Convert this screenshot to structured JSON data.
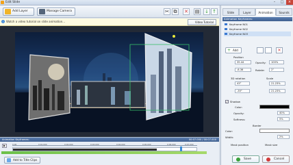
{
  "window": {
    "title": "Edit Slide"
  },
  "toolbar": {
    "add_layer": "Add Layer",
    "manage_camera": "Manage Camera"
  },
  "info": {
    "text": "Watch a video tutorial on slide animation...",
    "video_tutorial": "Video Tutorial"
  },
  "tabs": [
    "Slide",
    "Layer",
    "Animation",
    "Sounds"
  ],
  "keyframes": {
    "header": "Animation Keyframes:",
    "items": [
      "Keyframe N01",
      "Keyframe N02",
      "Keyframe N03"
    ],
    "add": "Add"
  },
  "props": {
    "position_hdr": "Position",
    "x": "35.44",
    "y": "-6.36",
    "opacity": "100%",
    "rotate": "2°",
    "rotation_hdr": "3D rotation",
    "rx": "43°",
    "ry": "-35°",
    "scale_hdr": "Scale",
    "sx": "21.23%",
    "sy": "21.23%",
    "opacity_lbl": "Opacity:",
    "rotate_lbl": "Rotate:",
    "shadow": "Shadow",
    "color": "Color:",
    "shadow_opacity": "Opacity:",
    "shadow_opacity_val": "40%",
    "softness": "Softness:",
    "softness_val": "5%",
    "border_hdr": "Border",
    "border_color": "Color:",
    "width": "Width:",
    "width_val": "2%",
    "mask_position": "Mask position",
    "mask_size": "Mask size"
  },
  "timeline": {
    "header": "Animation Keyframes:",
    "time": "00:07.000 / 00:07.000",
    "ticks": [
      "0:00",
      "0:01.000",
      "0:02.000",
      "0:03.000",
      "0:04.000",
      "0:05.000",
      "0:06.000",
      "0:07.000"
    ]
  },
  "bottom": {
    "add_title": "Add to Title Clips",
    "save": "Save",
    "cancel": "Cancel"
  },
  "colors": {
    "accent": "#3f5f8f",
    "save": "#3aa13a",
    "cancel": "#d23a3a"
  }
}
